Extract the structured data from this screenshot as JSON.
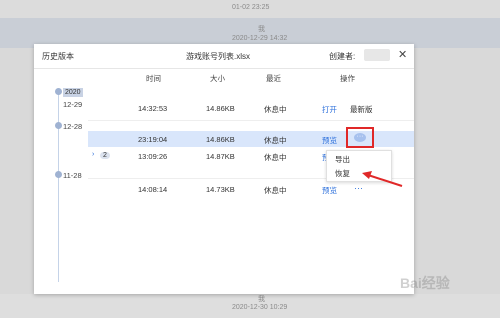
{
  "background": {
    "top_time": "01-02 23:25",
    "band_label": "我",
    "band_time": "2020-12-29 14:32",
    "bottom_label": "我",
    "bottom_time": "2020-12-30 10:29"
  },
  "modal": {
    "title": "历史版本",
    "file_name": "游戏账号列表.xlsx",
    "creator_label": "创建者:",
    "close_symbol": "✕",
    "columns": {
      "time": "时间",
      "size": "大小",
      "recent": "最近",
      "action": "操作"
    }
  },
  "timeline": {
    "year": "2020",
    "dates": [
      "12-29",
      "12-28",
      "11-28"
    ]
  },
  "rows": [
    {
      "time": "14:32:53",
      "size": "14.86KB",
      "recent": "休息中",
      "action1": "打开",
      "action2": "最新版"
    },
    {
      "time": "23:19:04",
      "size": "14.86KB",
      "recent": "休息中",
      "action1": "预览",
      "action2": "···"
    },
    {
      "time": "13:09:26",
      "size": "14.87KB",
      "recent": "休息中",
      "action1": "预览",
      "action2": "···",
      "expand_symbol": "›",
      "count": "2"
    },
    {
      "time": "14:08:14",
      "size": "14.73KB",
      "recent": "休息中",
      "action1": "预览",
      "action2": "···"
    }
  ],
  "more_menu": {
    "items": [
      "导出",
      "恢复"
    ]
  },
  "colors": {
    "link": "#2a6edb",
    "highlight_border": "#e02828",
    "selected_row": "#d9e6fb"
  },
  "watermark": "Bai经验"
}
